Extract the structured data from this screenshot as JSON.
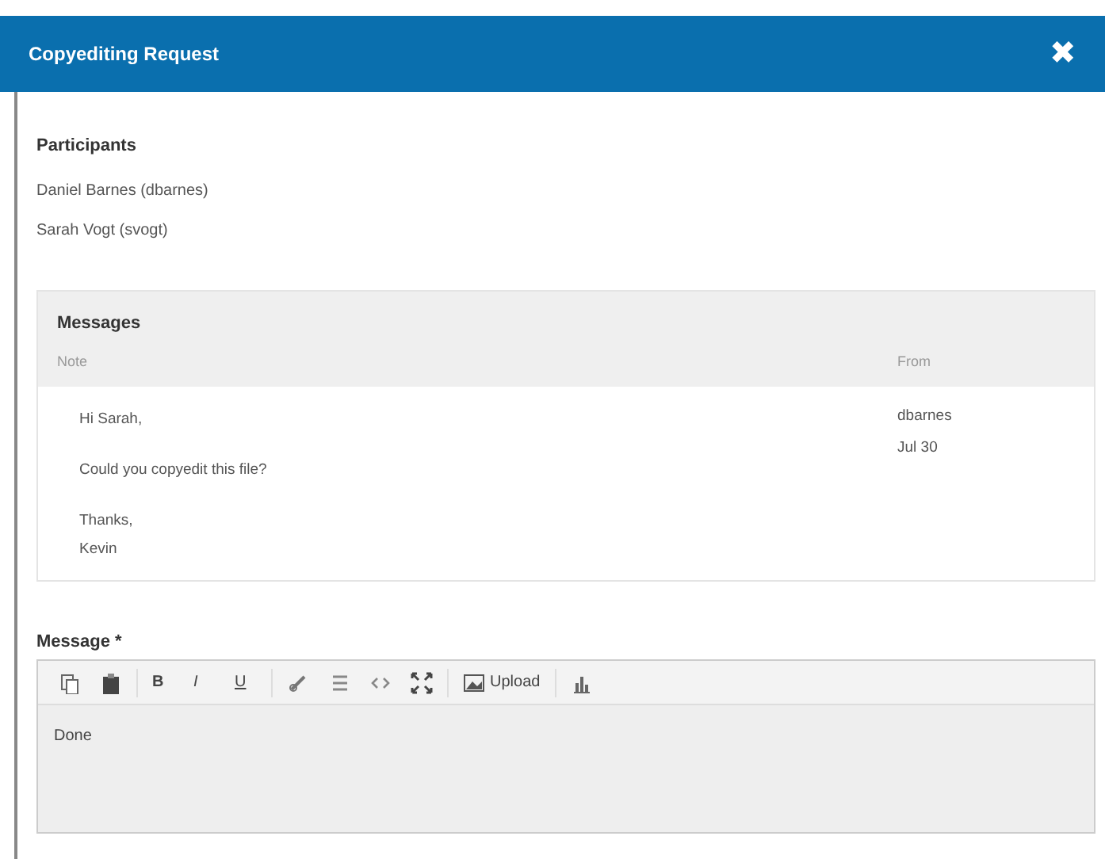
{
  "dialog": {
    "title": "Copyediting Request",
    "close": "✖"
  },
  "participants": {
    "title": "Participants",
    "items": [
      "Daniel Barnes (dbarnes)",
      "Sarah Vogt (svogt)"
    ]
  },
  "messages": {
    "title": "Messages",
    "columns": [
      "Note",
      "From"
    ],
    "rows": [
      {
        "lines": [
          "Hi Sarah,",
          "Could you copyedit this file?",
          "Thanks,\nKevin"
        ],
        "from": [
          "dbarnes",
          "Jul 30"
        ]
      }
    ]
  },
  "message_field": {
    "label": "Message *",
    "value": "Done",
    "toolbar": [
      {
        "kind": "copy"
      },
      {
        "kind": "paste"
      },
      {
        "kind": "bold",
        "label": "B"
      },
      {
        "kind": "italic",
        "label": "I"
      },
      {
        "kind": "underline",
        "label": "U"
      },
      {
        "kind": "link"
      },
      {
        "kind": "unlink"
      },
      {
        "kind": "code"
      },
      {
        "kind": "fullscreen"
      },
      {
        "kind": "upload",
        "label": "Upload"
      },
      {
        "kind": "chart"
      }
    ]
  }
}
